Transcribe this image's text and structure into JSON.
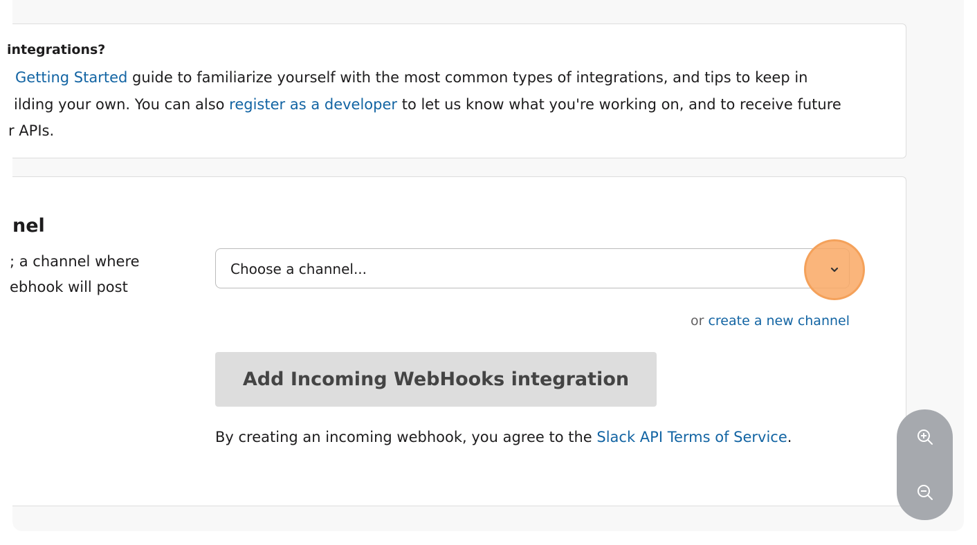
{
  "help": {
    "title": "integrations?",
    "line1_pre": "",
    "line1_link": "Getting Started",
    "line1_post": " guide to familiarize yourself with the most common types of integrations, and tips to keep in",
    "line2_pre": "ilding your own. You can also ",
    "line2_link": "register as a developer",
    "line2_post": " to let us know what you're working on, and to receive future",
    "line3": "r APIs."
  },
  "section": {
    "title": "nel",
    "desc_line1": "; a channel where",
    "desc_line2": "ebhook will post"
  },
  "select": {
    "placeholder": "Choose a channel...",
    "chevron_icon": "chevron-down-icon"
  },
  "create_channel": {
    "prefix": "or ",
    "link": "create a new channel"
  },
  "add_button": {
    "label": "Add Incoming WebHooks integration"
  },
  "terms": {
    "pre": "By creating an incoming webhook, you agree to the ",
    "link": "Slack API Terms of Service",
    "post": "."
  },
  "zoom": {
    "in_icon": "zoom-in-icon",
    "out_icon": "zoom-out-icon"
  },
  "colors": {
    "link": "#1264a3",
    "highlight": "#f4a15a",
    "button_bg": "#dddddd",
    "zoom_bg": "#a6a9ae"
  }
}
